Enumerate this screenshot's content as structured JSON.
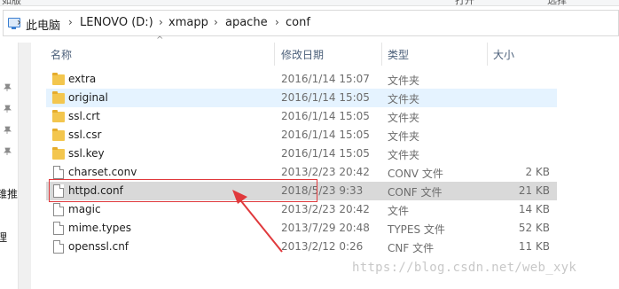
{
  "ribbon": {
    "items": [
      "如版",
      "打开",
      "选择"
    ]
  },
  "address": {
    "crumbs": [
      "此电脑",
      "LENOVO (D:)",
      "xmapp",
      "apache",
      "conf"
    ],
    "separator": "›"
  },
  "nav": {
    "texts": [
      "锥推",
      "理"
    ]
  },
  "columns": {
    "name": "名称",
    "date": "修改日期",
    "type": "类型",
    "size": "大小"
  },
  "files": [
    {
      "name": "extra",
      "date": "2016/1/14 15:07",
      "type": "文件夹",
      "size": "",
      "kind": "folder"
    },
    {
      "name": "original",
      "date": "2016/1/14 15:05",
      "type": "文件夹",
      "size": "",
      "kind": "folder"
    },
    {
      "name": "ssl.crt",
      "date": "2016/1/14 15:05",
      "type": "文件夹",
      "size": "",
      "kind": "folder"
    },
    {
      "name": "ssl.csr",
      "date": "2016/1/14 15:05",
      "type": "文件夹",
      "size": "",
      "kind": "folder"
    },
    {
      "name": "ssl.key",
      "date": "2016/1/14 15:05",
      "type": "文件夹",
      "size": "",
      "kind": "folder"
    },
    {
      "name": "charset.conv",
      "date": "2013/2/23 20:42",
      "type": "CONV 文件",
      "size": "2 KB",
      "kind": "file"
    },
    {
      "name": "httpd.conf",
      "date": "2018/5/23 9:33",
      "type": "CONF 文件",
      "size": "21 KB",
      "kind": "file"
    },
    {
      "name": "magic",
      "date": "2013/2/23 20:42",
      "type": "文件",
      "size": "14 KB",
      "kind": "file"
    },
    {
      "name": "mime.types",
      "date": "2013/7/29 20:48",
      "type": "TYPES 文件",
      "size": "52 KB",
      "kind": "file"
    },
    {
      "name": "openssl.cnf",
      "date": "2013/2/12 0:26",
      "type": "CNF 文件",
      "size": "11 KB",
      "kind": "file"
    }
  ],
  "watermark": "https://blog.csdn.net/web_xyk",
  "colors": {
    "annotation": "#e0393c",
    "selected_row": "#d9d9d9",
    "hover_row": "#e5f3ff",
    "header_text": "#4c607a"
  }
}
